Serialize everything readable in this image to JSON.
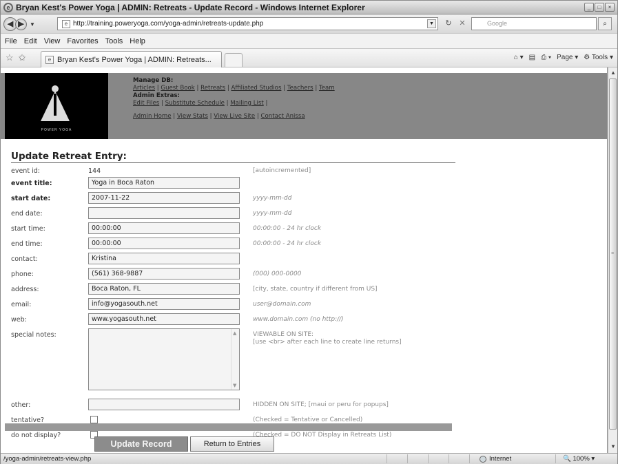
{
  "window": {
    "title": "Bryan Kest's Power Yoga | ADMIN: Retreats - Update Record - Windows Internet Explorer",
    "controls": [
      "_",
      "□",
      "×"
    ]
  },
  "addressbar": {
    "url": "http://training.poweryoga.com/yoga-admin/retreats-update.php",
    "search_placeholder": "Google"
  },
  "menu": [
    "File",
    "Edit",
    "View",
    "Favorites",
    "Tools",
    "Help"
  ],
  "tab": {
    "label": "Bryan Kest's Power Yoga | ADMIN: Retreats..."
  },
  "commandbar": {
    "page_label": "Page",
    "tools_label": "Tools"
  },
  "admin_nav": {
    "manage_heading": "Manage DB:",
    "manage_links": [
      "Articles",
      "Guest Book",
      "Retreats",
      "Affiliated Studios",
      "Teachers",
      "Team"
    ],
    "extras_heading": "Admin Extras:",
    "extras_links": [
      "Edit Files",
      "Substitute Schedule",
      "Mailing List"
    ],
    "bottom_links": [
      "Admin Home",
      "View Stats",
      "View Live Site",
      "Contact Anissa"
    ],
    "logo_tagline": "POWER YOGA"
  },
  "form": {
    "title": "Update Retreat Entry:",
    "event_id": {
      "label": "event id:",
      "value": "144",
      "hint": "[autoincremented]"
    },
    "event_title": {
      "label": "event title:",
      "value": "Yoga in Boca Raton"
    },
    "start_date": {
      "label": "start date:",
      "value": "2007-11-22",
      "hint": "yyyy-mm-dd"
    },
    "end_date": {
      "label": "end date:",
      "value": "",
      "hint": "yyyy-mm-dd"
    },
    "start_time": {
      "label": "start time:",
      "value": "00:00:00",
      "hint": "00:00:00 - 24 hr clock"
    },
    "end_time": {
      "label": "end time:",
      "value": "00:00:00",
      "hint": "00:00:00 - 24 hr clock"
    },
    "contact": {
      "label": "contact:",
      "value": "Kristina"
    },
    "phone": {
      "label": "phone:",
      "value": "(561) 368-9887",
      "hint": "(000) 000-0000"
    },
    "address": {
      "label": "address:",
      "value": "Boca Raton, FL",
      "hint": "[city, state, country if different from US]"
    },
    "email": {
      "label": "email:",
      "value": "info@yogasouth.net",
      "hint": "user@domain.com"
    },
    "web": {
      "label": "web:",
      "value": "www.yogasouth.net",
      "hint": "www.domain.com (no http://)"
    },
    "special_notes": {
      "label": "special notes:",
      "hint1": "VIEWABLE ON SITE:",
      "hint2": "[use <br> after each line to create line returns]"
    },
    "other": {
      "label": "other:",
      "value": "",
      "hint": "HIDDEN ON SITE; [maui or peru for popups]"
    },
    "tentative": {
      "label": "tentative?",
      "hint": "(Checked = Tentative or Cancelled)"
    },
    "do_not_display": {
      "label": "do not display?",
      "hint": "(Checked = DO NOT Display in Retreats List)"
    },
    "submit_label": "Update Record",
    "return_label": "Return to Entries"
  },
  "statusbar": {
    "link": "/yoga-admin/retreats-view.php",
    "zone": "Internet",
    "zoom": "100%"
  }
}
